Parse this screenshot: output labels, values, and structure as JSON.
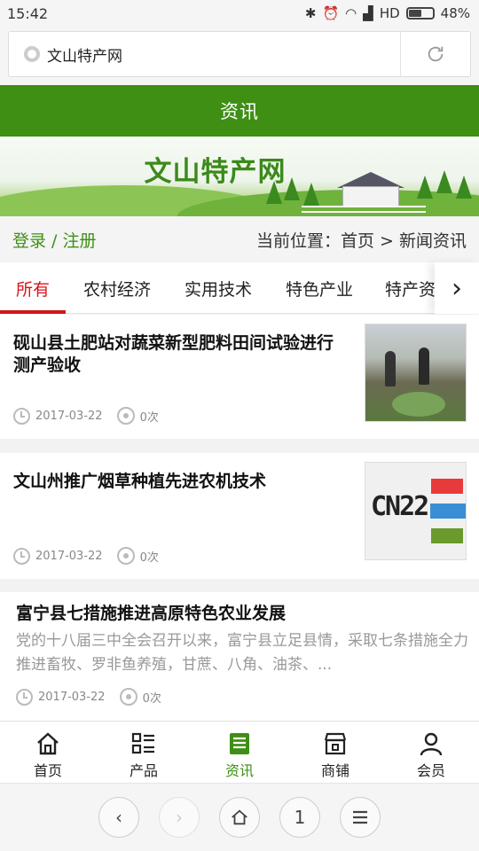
{
  "status_bar": {
    "time": "15:42",
    "network": "HD",
    "battery": "48%"
  },
  "address_bar": {
    "url_text": "文山特产网"
  },
  "header": {
    "title": "资讯"
  },
  "banner": {
    "title": "文山特产网"
  },
  "crumb_bar": {
    "login_text": "登录 / 注册",
    "breadcrumb_text": "当前位置：首页 > 新闻资讯"
  },
  "tabs": [
    {
      "label": "所有",
      "active": true
    },
    {
      "label": "农村经济",
      "active": false
    },
    {
      "label": "实用技术",
      "active": false
    },
    {
      "label": "特色产业",
      "active": false
    },
    {
      "label": "特产资",
      "active": false
    }
  ],
  "news": [
    {
      "title": "砚山县土肥站对蔬菜新型肥料田间试验进行测产验收",
      "date": "2017-03-22",
      "views": "0次",
      "thumb": "field-photo"
    },
    {
      "title": "文山州推广烟草种植先进农机技术",
      "date": "2017-03-22",
      "views": "0次",
      "thumb": "cn22-logo",
      "thumb_text": "CN22"
    },
    {
      "title": "富宁县七措施推进高原特色农业发展",
      "desc": "党的十八届三中全会召开以来，富宁县立足县情，采取七条措施全力推进畜牧、罗非鱼养殖，甘蔗、八角、油茶、...",
      "date": "2017-03-22",
      "views": "0次"
    }
  ],
  "bottom_nav": [
    {
      "label": "首页",
      "icon": "home-icon",
      "active": false
    },
    {
      "label": "产品",
      "icon": "list-icon",
      "active": false
    },
    {
      "label": "资讯",
      "icon": "news-icon",
      "active": true
    },
    {
      "label": "商铺",
      "icon": "shop-icon",
      "active": false
    },
    {
      "label": "会员",
      "icon": "user-icon",
      "active": false
    }
  ],
  "browser_bar": {
    "tab_count": "1"
  },
  "colors": {
    "brand_green": "#3e8f14",
    "active_red": "#d4151b"
  }
}
